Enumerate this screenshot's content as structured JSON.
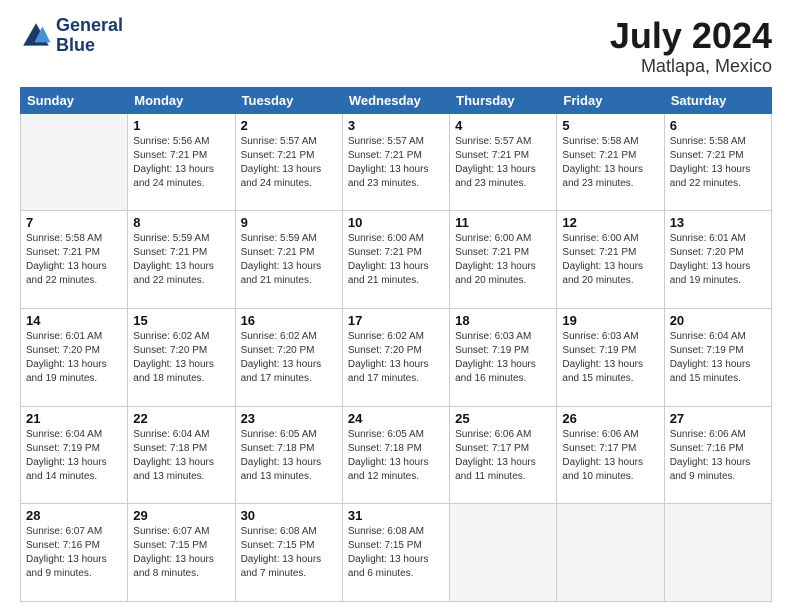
{
  "logo": {
    "line1": "General",
    "line2": "Blue"
  },
  "header": {
    "month": "July 2024",
    "location": "Matlapa, Mexico"
  },
  "weekdays": [
    "Sunday",
    "Monday",
    "Tuesday",
    "Wednesday",
    "Thursday",
    "Friday",
    "Saturday"
  ],
  "weeks": [
    [
      {
        "day": "",
        "empty": true
      },
      {
        "day": "1",
        "sunrise": "5:56 AM",
        "sunset": "7:21 PM",
        "daylight": "13 hours and 24 minutes."
      },
      {
        "day": "2",
        "sunrise": "5:57 AM",
        "sunset": "7:21 PM",
        "daylight": "13 hours and 24 minutes."
      },
      {
        "day": "3",
        "sunrise": "5:57 AM",
        "sunset": "7:21 PM",
        "daylight": "13 hours and 23 minutes."
      },
      {
        "day": "4",
        "sunrise": "5:57 AM",
        "sunset": "7:21 PM",
        "daylight": "13 hours and 23 minutes."
      },
      {
        "day": "5",
        "sunrise": "5:58 AM",
        "sunset": "7:21 PM",
        "daylight": "13 hours and 23 minutes."
      },
      {
        "day": "6",
        "sunrise": "5:58 AM",
        "sunset": "7:21 PM",
        "daylight": "13 hours and 22 minutes."
      }
    ],
    [
      {
        "day": "7",
        "sunrise": "5:58 AM",
        "sunset": "7:21 PM",
        "daylight": "13 hours and 22 minutes."
      },
      {
        "day": "8",
        "sunrise": "5:59 AM",
        "sunset": "7:21 PM",
        "daylight": "13 hours and 22 minutes."
      },
      {
        "day": "9",
        "sunrise": "5:59 AM",
        "sunset": "7:21 PM",
        "daylight": "13 hours and 21 minutes."
      },
      {
        "day": "10",
        "sunrise": "6:00 AM",
        "sunset": "7:21 PM",
        "daylight": "13 hours and 21 minutes."
      },
      {
        "day": "11",
        "sunrise": "6:00 AM",
        "sunset": "7:21 PM",
        "daylight": "13 hours and 20 minutes."
      },
      {
        "day": "12",
        "sunrise": "6:00 AM",
        "sunset": "7:21 PM",
        "daylight": "13 hours and 20 minutes."
      },
      {
        "day": "13",
        "sunrise": "6:01 AM",
        "sunset": "7:20 PM",
        "daylight": "13 hours and 19 minutes."
      }
    ],
    [
      {
        "day": "14",
        "sunrise": "6:01 AM",
        "sunset": "7:20 PM",
        "daylight": "13 hours and 19 minutes."
      },
      {
        "day": "15",
        "sunrise": "6:02 AM",
        "sunset": "7:20 PM",
        "daylight": "13 hours and 18 minutes."
      },
      {
        "day": "16",
        "sunrise": "6:02 AM",
        "sunset": "7:20 PM",
        "daylight": "13 hours and 17 minutes."
      },
      {
        "day": "17",
        "sunrise": "6:02 AM",
        "sunset": "7:20 PM",
        "daylight": "13 hours and 17 minutes."
      },
      {
        "day": "18",
        "sunrise": "6:03 AM",
        "sunset": "7:19 PM",
        "daylight": "13 hours and 16 minutes."
      },
      {
        "day": "19",
        "sunrise": "6:03 AM",
        "sunset": "7:19 PM",
        "daylight": "13 hours and 15 minutes."
      },
      {
        "day": "20",
        "sunrise": "6:04 AM",
        "sunset": "7:19 PM",
        "daylight": "13 hours and 15 minutes."
      }
    ],
    [
      {
        "day": "21",
        "sunrise": "6:04 AM",
        "sunset": "7:19 PM",
        "daylight": "13 hours and 14 minutes."
      },
      {
        "day": "22",
        "sunrise": "6:04 AM",
        "sunset": "7:18 PM",
        "daylight": "13 hours and 13 minutes."
      },
      {
        "day": "23",
        "sunrise": "6:05 AM",
        "sunset": "7:18 PM",
        "daylight": "13 hours and 13 minutes."
      },
      {
        "day": "24",
        "sunrise": "6:05 AM",
        "sunset": "7:18 PM",
        "daylight": "13 hours and 12 minutes."
      },
      {
        "day": "25",
        "sunrise": "6:06 AM",
        "sunset": "7:17 PM",
        "daylight": "13 hours and 11 minutes."
      },
      {
        "day": "26",
        "sunrise": "6:06 AM",
        "sunset": "7:17 PM",
        "daylight": "13 hours and 10 minutes."
      },
      {
        "day": "27",
        "sunrise": "6:06 AM",
        "sunset": "7:16 PM",
        "daylight": "13 hours and 9 minutes."
      }
    ],
    [
      {
        "day": "28",
        "sunrise": "6:07 AM",
        "sunset": "7:16 PM",
        "daylight": "13 hours and 9 minutes."
      },
      {
        "day": "29",
        "sunrise": "6:07 AM",
        "sunset": "7:15 PM",
        "daylight": "13 hours and 8 minutes."
      },
      {
        "day": "30",
        "sunrise": "6:08 AM",
        "sunset": "7:15 PM",
        "daylight": "13 hours and 7 minutes."
      },
      {
        "day": "31",
        "sunrise": "6:08 AM",
        "sunset": "7:15 PM",
        "daylight": "13 hours and 6 minutes."
      },
      {
        "day": "",
        "empty": true
      },
      {
        "day": "",
        "empty": true
      },
      {
        "day": "",
        "empty": true
      }
    ]
  ]
}
